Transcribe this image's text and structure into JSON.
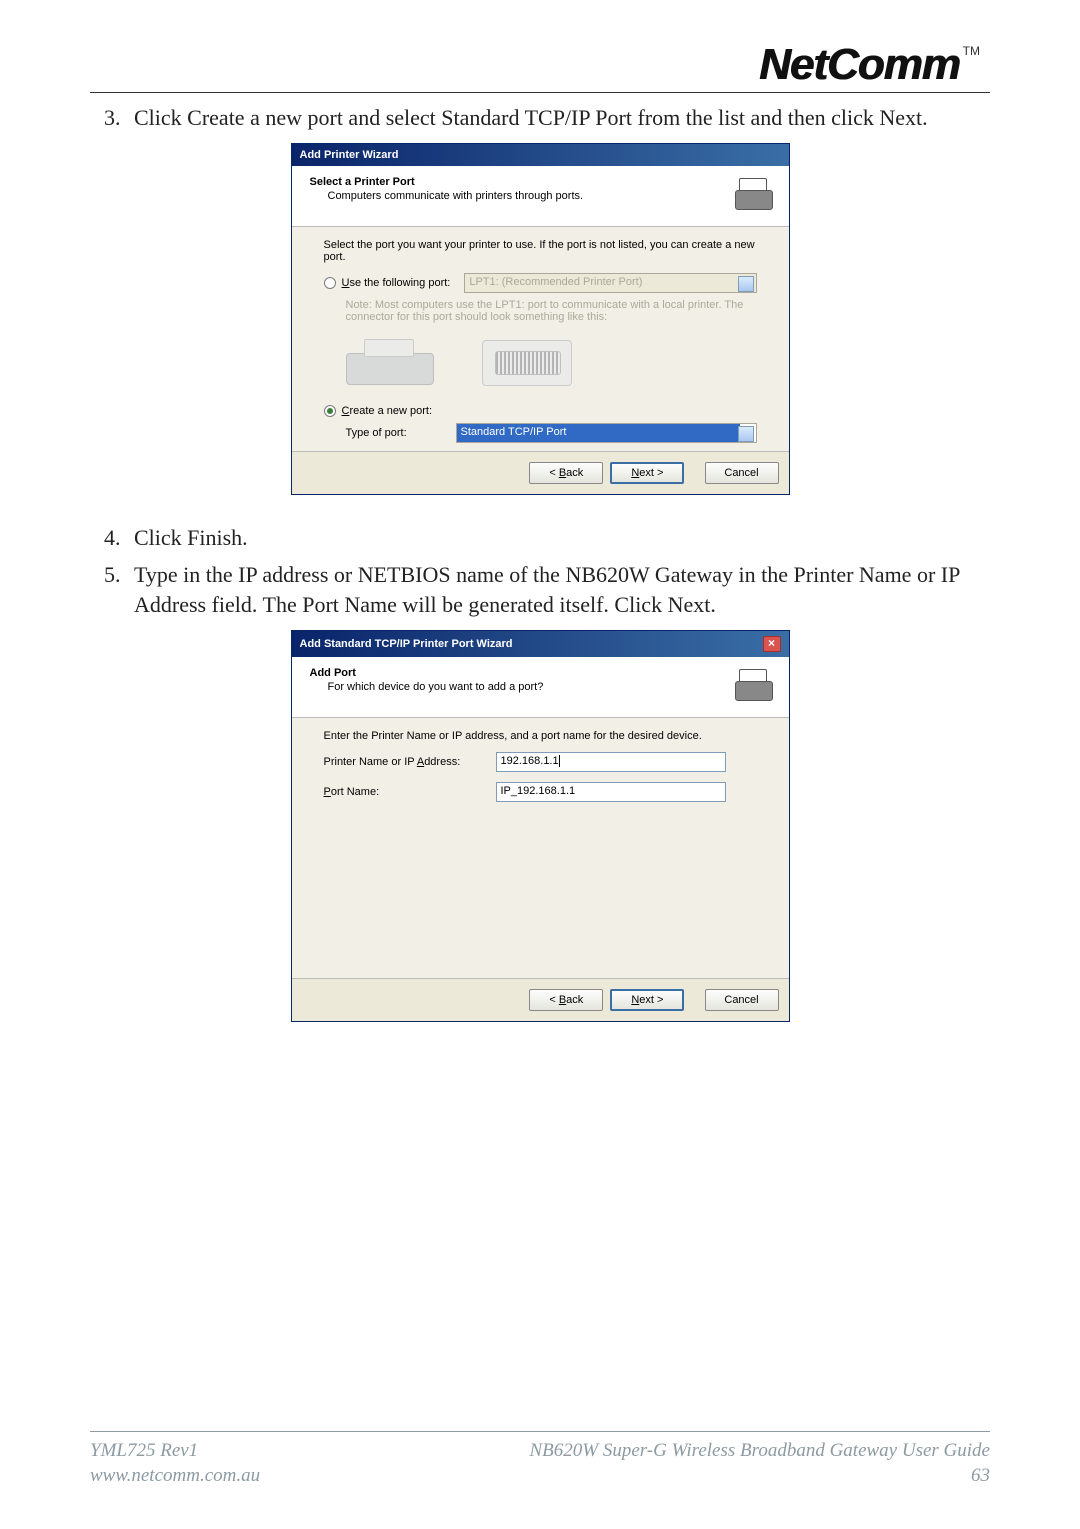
{
  "logo": {
    "brand": "NetComm",
    "tm": "TM"
  },
  "instructions": {
    "item3_num": "3.",
    "item3_text": "Click Create a new port and select Standard TCP/IP Port from the list and then click Next.",
    "item4_num": "4.",
    "item4_text": "Click Finish.",
    "item5_num": "5.",
    "item5_text": "Type in the IP address or NETBIOS name of the NB620W Gateway in the Printer Name or IP Address field.  The Port Name will be generated itself.  Click Next."
  },
  "wizard1": {
    "title": "Add Printer Wizard",
    "header_title": "Select a Printer Port",
    "header_sub": "Computers communicate with printers through ports.",
    "instruction": "Select the port you want your printer to use.  If the port is not listed, you can create a new port.",
    "radio_use_prefix": "U",
    "radio_use": "se the following port:",
    "lpt_value": "LPT1: (Recommended Printer Port)",
    "note": "Note: Most computers use the LPT1: port to communicate with a local printer. The connector for this port should look something like this:",
    "radio_create_prefix": "C",
    "radio_create": "reate a new port:",
    "type_label": "Type of port:",
    "type_value": "Standard TCP/IP Port",
    "back_key": "B",
    "back": "ack",
    "next_key": "N",
    "next": "ext >",
    "cancel": "Cancel"
  },
  "wizard2": {
    "title": "Add Standard TCP/IP Printer Port Wizard",
    "header_title": "Add Port",
    "header_sub": "For which device do you want to add a port?",
    "instruction": "Enter the Printer Name or IP address, and a port name for the desired device.",
    "label_ip_pre": "Printer Name or IP ",
    "label_ip_key": "A",
    "label_ip_post": "ddress:",
    "value_ip": "192.168.1.1",
    "label_port_key": "P",
    "label_port": "ort Name:",
    "value_port": "IP_192.168.1.1",
    "back_key": "B",
    "back": "ack",
    "next_key": "N",
    "next": "ext >",
    "cancel": "Cancel"
  },
  "footer": {
    "left_line1": "YML725 Rev1",
    "left_line2": "www.netcomm.com.au",
    "right_line1": "NB620W Super-G Wireless Broadband  Gateway User Guide",
    "right_line2": "63"
  }
}
